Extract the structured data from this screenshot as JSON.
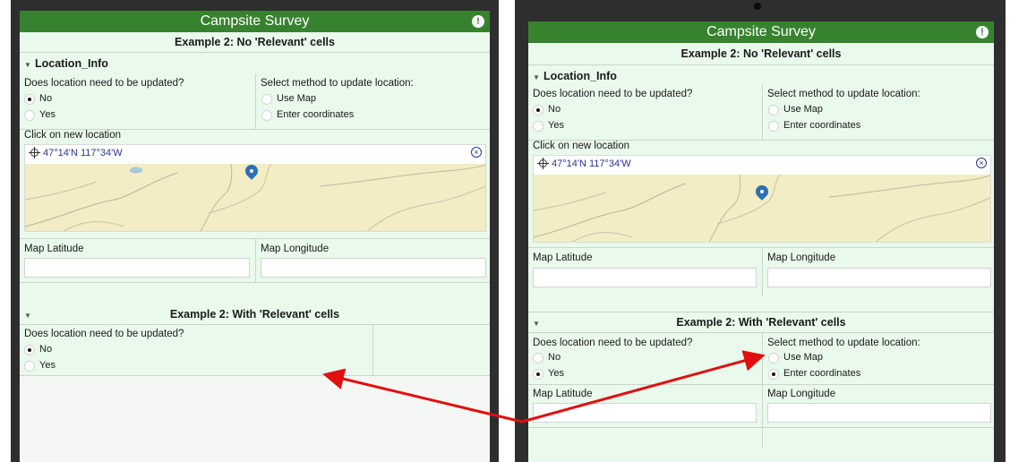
{
  "app": {
    "title": "Campsite Survey",
    "alert_icon": "alert-icon"
  },
  "left": {
    "section1_header": "Example 2: No 'Relevant' cells",
    "group_title": "Location_Info",
    "q_update": "Does location need to be updated?",
    "opt_no": "No",
    "opt_yes": "Yes",
    "q_method": "Select method to update location:",
    "opt_use_map": "Use Map",
    "opt_enter_coords": "Enter coordinates",
    "click_label": "Click on new location",
    "coords": "47°14'N 117°34'W",
    "map_latitude_label": "Map Latitude",
    "map_longitude_label": "Map Longitude",
    "section2_header": "Example 2: With 'Relevant' cells",
    "q_update_2": "Does location need to be updated?",
    "opt_no_2": "No",
    "opt_yes_2": "Yes",
    "selected_update": "No",
    "selected_update_2": "No"
  },
  "right": {
    "section1_header": "Example 2: No 'Relevant' cells",
    "group_title": "Location_Info",
    "q_update": "Does location need to be updated?",
    "opt_no": "No",
    "opt_yes": "Yes",
    "q_method": "Select method to update location:",
    "opt_use_map": "Use Map",
    "opt_enter_coords": "Enter coordinates",
    "click_label": "Click on new location",
    "coords": "47°14'N 117°34'W",
    "map_latitude_label": "Map Latitude",
    "map_longitude_label": "Map Longitude",
    "section2_header": "Example 2: With 'Relevant' cells",
    "q_update_2": "Does location need to be updated?",
    "opt_no_2": "No",
    "opt_yes_2": "Yes",
    "q_method_2": "Select method to update location:",
    "opt_use_map_2": "Use Map",
    "opt_enter_coords_2": "Enter coordinates",
    "map_latitude_label_2": "Map Latitude",
    "map_longitude_label_2": "Map Longitude",
    "selected_update": "No",
    "selected_update_2": "Yes",
    "selected_method_2": "Enter coordinates"
  },
  "colors": {
    "title_bar": "#37822f",
    "panel": "#e9f9ec",
    "coords_text": "#27368d",
    "annotation_arrow": "#e01010",
    "map_pin": "#2e6fb5"
  }
}
